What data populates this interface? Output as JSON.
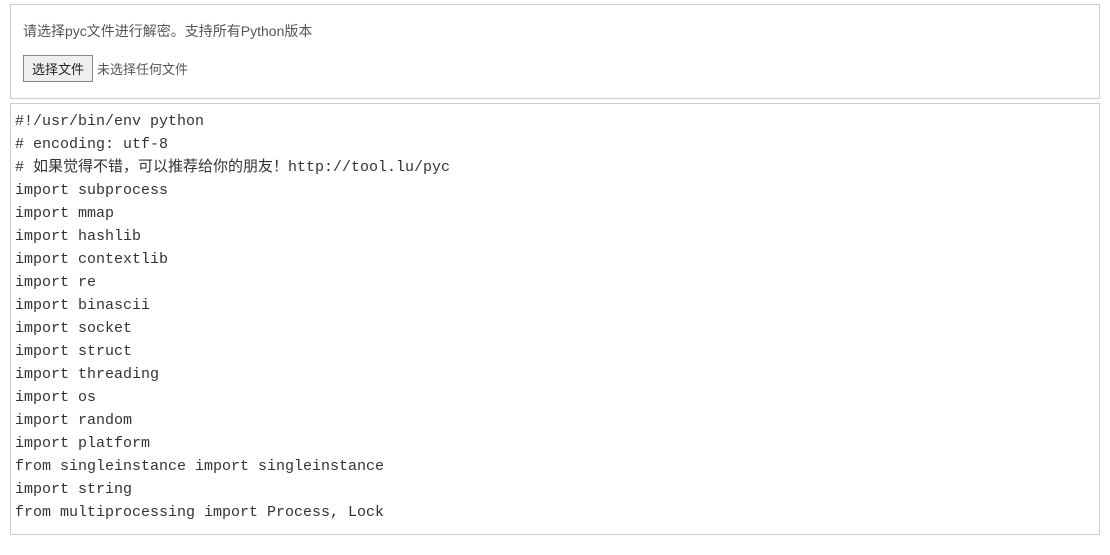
{
  "upload": {
    "instruction": "请选择pyc文件进行解密。支持所有Python版本",
    "button_label": "选择文件",
    "status_text": "未选择任何文件"
  },
  "code": {
    "lines": [
      "#!/usr/bin/env python",
      "# encoding: utf-8",
      "# 如果觉得不错，可以推荐给你的朋友！http://tool.lu/pyc",
      "import subprocess",
      "import mmap",
      "import hashlib",
      "import contextlib",
      "import re",
      "import binascii",
      "import socket",
      "import struct",
      "import threading",
      "import os",
      "import random",
      "import platform",
      "from singleinstance import singleinstance",
      "import string",
      "from multiprocessing import Process, Lock"
    ]
  }
}
